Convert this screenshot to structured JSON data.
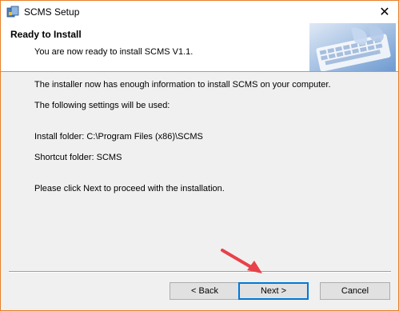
{
  "window": {
    "title": "SCMS Setup",
    "close_symbol": "✕",
    "accent_border_color": "#e8802a"
  },
  "header": {
    "title": "Ready to Install",
    "subtitle": "You are now ready to install SCMS V1.1."
  },
  "body": {
    "lines": [
      "The installer now has enough information to install SCMS on your computer.",
      "The following settings will be used:",
      "Install folder:  C:\\Program Files (x86)\\SCMS",
      "Shortcut folder:  SCMS",
      "Please click Next to proceed with the installation."
    ]
  },
  "buttons": {
    "back": "< Back",
    "next": "Next >",
    "cancel": "Cancel"
  },
  "annotation": {
    "arrow_color": "#e8414a"
  }
}
